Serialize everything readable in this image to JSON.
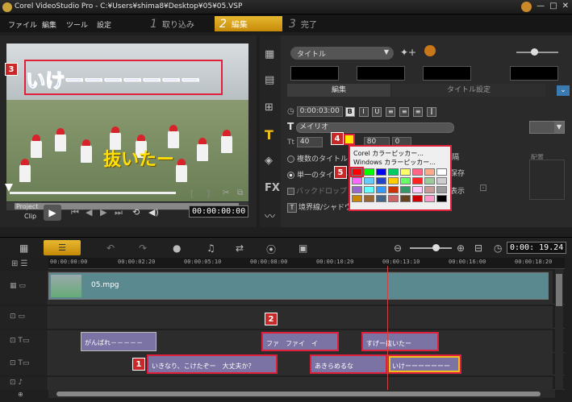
{
  "window": {
    "title": "Corel VideoStudio Pro - C:¥Users¥shima8¥Desktop¥05¥05.VSP",
    "minimize": "—",
    "maximize": "□",
    "close": "✕"
  },
  "menu": {
    "file": "ファイル",
    "edit": "編集",
    "tools": "ツール",
    "settings": "設定"
  },
  "steps": [
    {
      "num": "1",
      "label": "取り込み"
    },
    {
      "num": "2",
      "label": "編集"
    },
    {
      "num": "3",
      "label": "完了"
    }
  ],
  "preview": {
    "overlay_top": "いけーーーーーーー",
    "overlay_bottom": "抜いたー"
  },
  "badges": {
    "b1": "1",
    "b2": "2",
    "b3": "3",
    "b4": "4",
    "b5": "5"
  },
  "controls": {
    "project": "Project",
    "clip": "Clip",
    "mark_in": "[",
    "mark_out": "]",
    "timecode": "00:00:00:00",
    "play": "▶"
  },
  "library": {
    "category": "タイトル",
    "tab_edit": "編集",
    "tab_title_settings": "タイトル設定",
    "duration": "0:00:03:00",
    "bold": "B",
    "italic": "I",
    "underline": "U",
    "font": "メイリオ",
    "font_size": "40",
    "line_spacing": "80",
    "rotation": "0",
    "multi_title": "複数のタイトル",
    "single_title": "単一のタイトル",
    "backdrop": "バックドロップ",
    "border_shadow": "境界線/シャドウ",
    "fragment_1": "隔",
    "fragment_2": "保存",
    "fragment_3": "表示",
    "alignment_label": "配置"
  },
  "color_picker": {
    "corel": "Corel カラーピッカー...",
    "windows": "Windows カラーピッカー...",
    "palette": [
      "#ff0000",
      "#00ff00",
      "#0000ff",
      "#00cc66",
      "#ffff66",
      "#ff6688",
      "#ffaa88",
      "#ffffff",
      "#ff66ff",
      "#66ccff",
      "#2244cc",
      "#ffcc00",
      "#66ff66",
      "#ff2222",
      "#99cc99",
      "#cccccc",
      "#9966cc",
      "#66ffff",
      "#3399ff",
      "#cc3300",
      "#339966",
      "#ffccff",
      "#cc9999",
      "#999999",
      "#cc8800",
      "#996633",
      "#446688",
      "#cc6666",
      "#664422",
      "#cc0000",
      "#ff99cc",
      "#000000"
    ]
  },
  "timeline": {
    "timecode": "0:00: 19.24",
    "ruler": [
      "00:00:00:00",
      "00:00:02:20",
      "00:00:05:10",
      "00:00:08:00",
      "00:00:10:20",
      "00:00:13:10",
      "00:00:16:00",
      "00:00:18:20"
    ],
    "video_clip": "05.mpg",
    "title_track_1": [
      {
        "label": "がんばれ－－－－－"
      },
      {
        "label": "ファ　ファイ　イ"
      },
      {
        "label": "すげー抜いたー"
      }
    ],
    "title_track_2": [
      {
        "label": "いきなり、こけたぞー　大丈夫か？"
      },
      {
        "label": "あきらめるな"
      },
      {
        "label": "いけーーーーーーー"
      }
    ]
  }
}
